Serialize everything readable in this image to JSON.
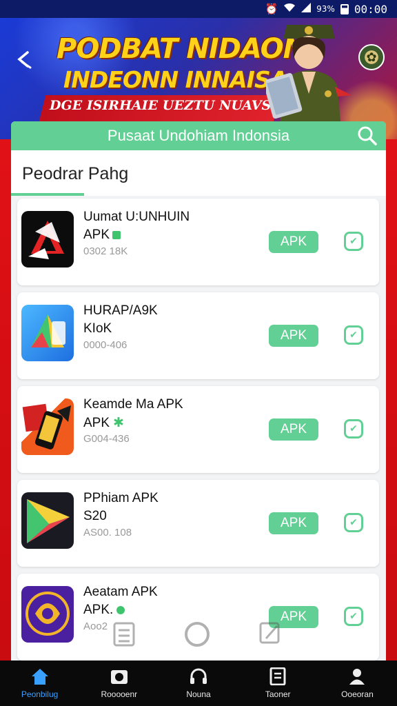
{
  "status_bar": {
    "battery_text": "93%",
    "time": "00:00"
  },
  "banner": {
    "title_line1": "PODBAT NIDAON",
    "title_line2": "INDEONN INNAISA",
    "subtitle": "DGE ISIRHAIE UEZTU NUAVSNON"
  },
  "header": {
    "title": "Pusaat Undohiam Indonsia"
  },
  "section": {
    "label": "Peodrar Pahg"
  },
  "apps": [
    {
      "name": "Uumat U:UNHUIN",
      "sub": "APK",
      "meta": "0302 18K",
      "button": "APK",
      "icon": "app-icon-red-triangle"
    },
    {
      "name": "HURAP/A9K",
      "sub": "KIoK",
      "meta": "0000-406",
      "button": "APK",
      "icon": "app-icon-blue-triangle"
    },
    {
      "name": "Keamde Ma APK",
      "sub": "APK",
      "meta": "G004-436",
      "button": "APK",
      "icon": "app-icon-phone-cards"
    },
    {
      "name": "PPhiam APK",
      "sub": "S20",
      "meta": "AS00. 108",
      "button": "APK",
      "icon": "app-icon-play-triangle"
    },
    {
      "name": "Aeatam APK",
      "sub": "APK.",
      "meta": "Aoo2",
      "button": "APK",
      "icon": "app-icon-purple-flower"
    }
  ],
  "bottom_nav": [
    {
      "label": "Peonbilug",
      "icon": "home-icon",
      "active": true
    },
    {
      "label": "Rooooenr",
      "icon": "camera-icon",
      "active": false
    },
    {
      "label": "Nouna",
      "icon": "headset-icon",
      "active": false
    },
    {
      "label": "Taoner",
      "icon": "document-icon",
      "active": false
    },
    {
      "label": "Ooeoran",
      "icon": "profile-icon",
      "active": false
    }
  ],
  "colors": {
    "accent": "#62cf94",
    "background_red": "#e8151a",
    "status_bar": "#0d1a66",
    "nav_active": "#3aa0ff"
  }
}
